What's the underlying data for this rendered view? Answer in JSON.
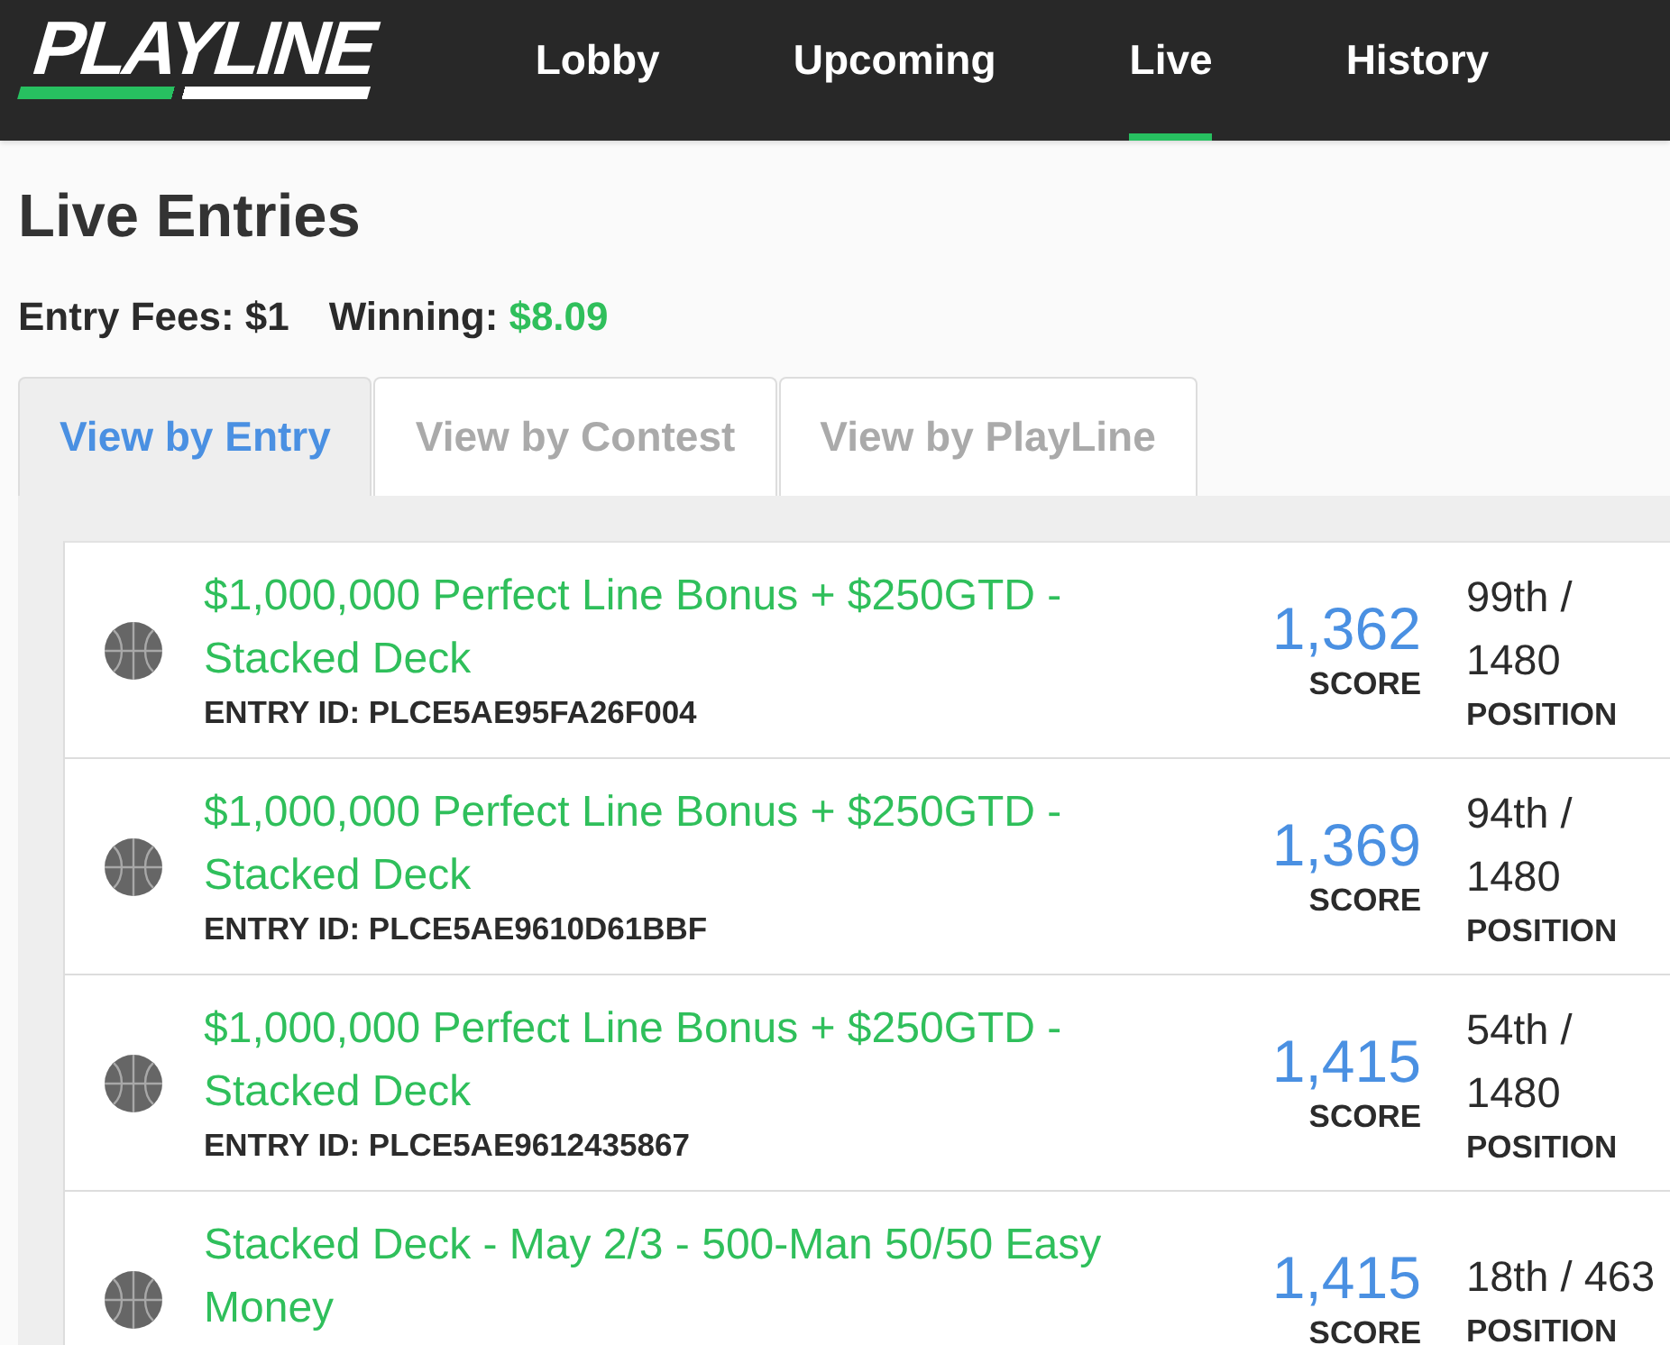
{
  "header": {
    "logo": "PLAYLINE",
    "nav": [
      {
        "label": "Lobby",
        "selected": false
      },
      {
        "label": "Upcoming",
        "selected": false
      },
      {
        "label": "Live",
        "selected": true
      },
      {
        "label": "History",
        "selected": false
      }
    ]
  },
  "page": {
    "title": "Live Entries",
    "stats": [
      {
        "label": "Entry Fees:",
        "value": "$1",
        "positive": false
      },
      {
        "label": "Winning:",
        "value": "$8.09",
        "positive": true
      }
    ]
  },
  "tabs": [
    {
      "label": "View by Entry",
      "selected": true
    },
    {
      "label": "View by Contest",
      "selected": false
    },
    {
      "label": "View by PlayLine",
      "selected": false
    }
  ],
  "entries": [
    {
      "kind": "basketball",
      "contest": "$1,000,000 Perfect Line Bonus + $250GTD - Stacked Deck",
      "entry_id": "ENTRY ID: PLCE5AE95FA26F004",
      "score": "1,362",
      "score_label": "SCORE",
      "position": "99th / 1480",
      "position_label": "POSITION"
    },
    {
      "kind": "basketball",
      "contest": "$1,000,000 Perfect Line Bonus + $250GTD - Stacked Deck",
      "entry_id": "ENTRY ID: PLCE5AE9610D61BBF",
      "score": "1,369",
      "score_label": "SCORE",
      "position": "94th / 1480",
      "position_label": "POSITION"
    },
    {
      "kind": "basketball",
      "contest": "$1,000,000 Perfect Line Bonus + $250GTD - Stacked Deck",
      "entry_id": "ENTRY ID: PLCE5AE9612435867",
      "score": "1,415",
      "score_label": "SCORE",
      "position": "54th / 1480",
      "position_label": "POSITION"
    },
    {
      "kind": "basketball",
      "contest": "Stacked Deck - May 2/3 - 500-Man 50/50 Easy Money",
      "score": "1,415",
      "score_label": "SCORE",
      "position": "18th / 463",
      "position_label": "POSITION"
    }
  ]
}
